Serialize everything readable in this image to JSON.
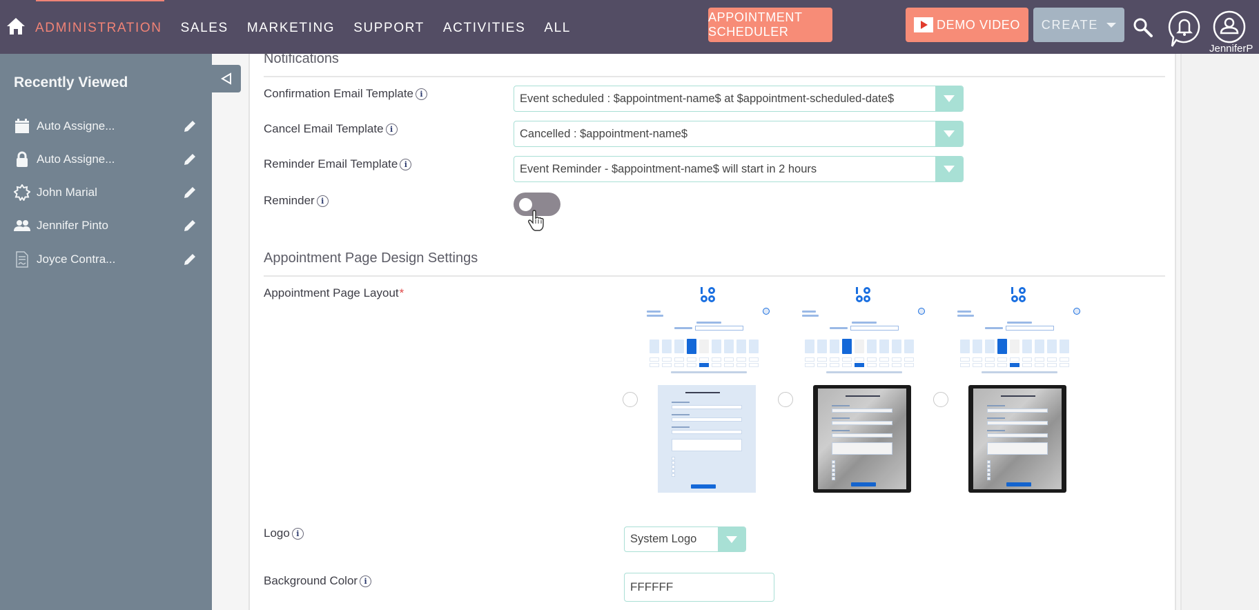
{
  "topbar": {
    "nav_items": [
      {
        "label": "ADMINISTRATION",
        "active": true
      },
      {
        "label": "SALES",
        "active": false
      },
      {
        "label": "MARKETING",
        "active": false
      },
      {
        "label": "SUPPORT",
        "active": false
      },
      {
        "label": "ACTIVITIES",
        "active": false
      },
      {
        "label": "ALL",
        "active": false
      }
    ],
    "appointment_scheduler_label": "APPOINTMENT SCHEDULER",
    "demo_video_label": "DEMO VIDEO",
    "create_label": "CREATE",
    "username": "JenniferP",
    "icons": {
      "home": "home-icon",
      "search": "search-icon",
      "notifications": "bell-icon",
      "user": "user-icon",
      "demo": "play-icon",
      "create_caret": "caret-down-icon"
    }
  },
  "colors": {
    "topbar_bg": "#534d64",
    "accent": "#f08376",
    "button_orange": "#f78c77",
    "button_create": "#a5b4c2",
    "sidebar_bg": "#738391",
    "select_border": "#a9dfd5",
    "select_arrow": "#a8e0d5",
    "toggle_off": "#8d8790",
    "preview_blue": "#1468d8"
  },
  "sidebar": {
    "title": "Recently Viewed",
    "items": [
      {
        "label": "Auto Assigne...",
        "icon": "calendar-icon"
      },
      {
        "label": "Auto Assigne...",
        "icon": "lock-icon"
      },
      {
        "label": "John Marial",
        "icon": "badge-icon"
      },
      {
        "label": "Jennifer Pinto",
        "icon": "users-icon"
      },
      {
        "label": "Joyce Contra...",
        "icon": "contract-icon"
      }
    ],
    "collapse_icon": "collapse-left-icon"
  },
  "notifications": {
    "title": "Notifications",
    "fields": [
      {
        "label": "Confirmation Email Template",
        "value": "Event scheduled : $appointment-name$ at $appointment-scheduled-date$"
      },
      {
        "label": "Cancel Email Template",
        "value": "Cancelled : $appointment-name$"
      },
      {
        "label": "Reminder Email Template",
        "value": "Event Reminder - $appointment-name$ will start in 2 hours"
      }
    ],
    "reminder": {
      "label": "Reminder",
      "enabled": false
    }
  },
  "design": {
    "title": "Appointment Page Design Settings",
    "layout_label": "Appointment Page Layout",
    "required_mark": "*",
    "layout_options": [
      {
        "name": "light-form-layout",
        "selected": false
      },
      {
        "name": "photo-background-layout",
        "selected": false
      },
      {
        "name": "photo-background-inline-layout",
        "selected": false
      }
    ],
    "logo": {
      "label": "Logo",
      "value": "System Logo"
    },
    "background_color": {
      "label": "Background Color",
      "value": "FFFFFF"
    }
  },
  "info_glyph": "i"
}
